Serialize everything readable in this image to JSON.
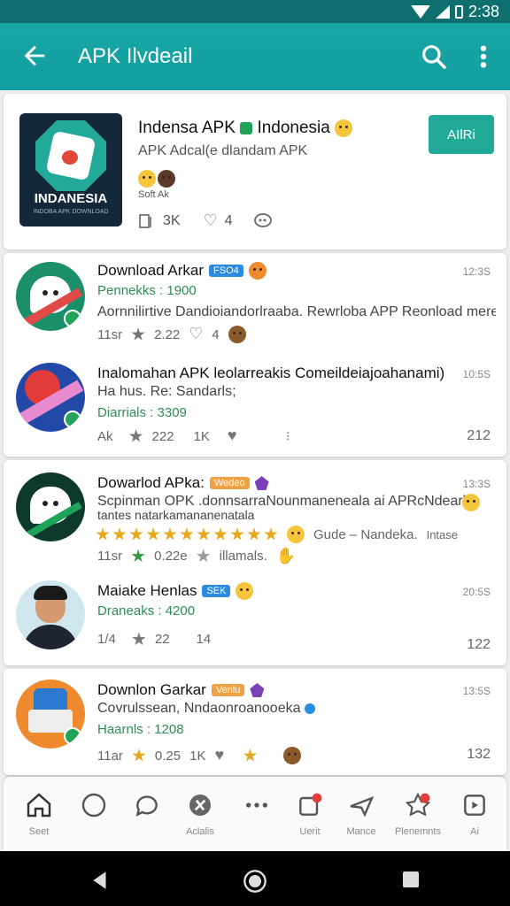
{
  "status_bar": {
    "time": "2:38"
  },
  "app_bar": {
    "title": "APK Ilvdeail"
  },
  "hero": {
    "icon_brand": "INDANESIA",
    "icon_sub": "INDOBA APK DOWNLOAD",
    "title": "Indensa APK",
    "title_tail": "Indonesia",
    "subtitle": "APK  Adcal(e dlandam APK",
    "caption": "Soft Ak",
    "stat_count": "3K",
    "stat_likes": "4",
    "action_label": "AIlRi"
  },
  "rows": [
    {
      "title": "Download Arkar",
      "tag": "FSO4",
      "time": "12:3S",
      "green": "Pennekks : 1900",
      "desc": "Aornnilirtive Dandioiandorlraaba. Rewrloba APP Reonload mere",
      "meta1": "11sr",
      "meta2": "2.22",
      "meta3": "4"
    },
    {
      "title": "Inalomahan APK leolarreakis Comeildeiajoahanami)",
      "subtitle": "Ha hus. Re: Sandarls;",
      "time": "10:5S",
      "green": "Diarrials : 3309",
      "meta1": "Ak",
      "meta2": "222",
      "meta3": "1K",
      "right": "212"
    },
    {
      "title": "Dowarlod APka:",
      "tag": "Wedeo",
      "time": "13:3S",
      "desc": "Scpinman OPK .donnsarraNounmaneneala ai APRcNdearks.",
      "desc2": "tantes natarkamananenatala",
      "rating_text": "Gude – Nandeka.",
      "rating_tail": "Intase",
      "meta1": "11sr",
      "meta2": "0.22e",
      "meta3": "illamals."
    },
    {
      "title": "Maiake Henlas",
      "tag": "SEK",
      "time": "20:5S",
      "green": "Draneaks : 4200",
      "meta1": "1/4",
      "meta2": "22",
      "meta3": "14",
      "right": "122"
    },
    {
      "title": "Downlon Garkar",
      "tag": "Venlu",
      "time": "13:5S",
      "desc": "Covrulssean, Nndaonroanooeka",
      "green": "Haarnls : 1208",
      "meta1": "11ar",
      "meta2": "0.25",
      "meta3": "1K",
      "right": "132"
    }
  ],
  "bottom_nav": [
    {
      "label": "Seet"
    },
    {
      "label": ""
    },
    {
      "label": ""
    },
    {
      "label": "Aclalis"
    },
    {
      "label": ""
    },
    {
      "label": "Uerit"
    },
    {
      "label": "Mance"
    },
    {
      "label": "Plenemnts"
    },
    {
      "label": "Ai"
    }
  ]
}
